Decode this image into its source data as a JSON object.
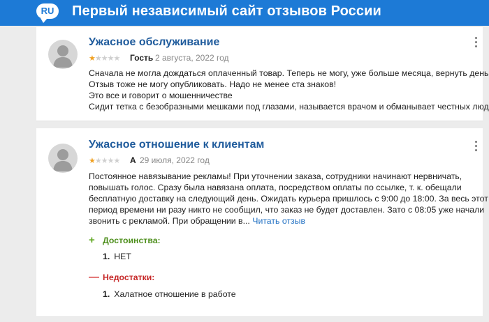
{
  "header": {
    "badge": "RU",
    "title": "Первый независимый сайт отзывов России"
  },
  "reviews": [
    {
      "title": "Ужасное обслуживание",
      "rating": 1,
      "stars_max": 5,
      "author": "Гость",
      "date": "2 августа, 2022 год",
      "lines": [
        "Сначала не могла дождаться оплаченный товар. Теперь не могу, уже больше месяца, вернуть деньги",
        "Отзыв тоже не могу опубликовать. Надо не менее ста знаков!",
        "Это все и говорит о мошенничестве",
        "Сидит тетка с безобразными мешками под глазами, называется врачом и обманывает честных людей"
      ]
    },
    {
      "title": "Ужасное отношение к клиентам",
      "rating": 1,
      "stars_max": 5,
      "author": "А",
      "date": "29 июля, 2022 год",
      "lines": [
        "Постоянное навязывание рекламы! При уточнении заказа, сотрудники начинают нервничать,",
        "повышать голос. Сразу была навязана оплата, посредством оплаты по ссылке, т. к. обещали",
        "бесплатную доставку на следующий день. Ожидать курьера пришлось с 9:00 до 18:00. За весь этот",
        "период времени ни разу никто не сообщил, что заказ не будет доставлен. Зато с 08:05 уже начали"
      ],
      "last_line": "звонить с рекламой. При обращении в...",
      "read_more": "Читать отзыв",
      "pros_label": "Достоинства:",
      "pros": [
        {
          "num": "1.",
          "text": "НЕТ"
        }
      ],
      "cons_label": "Недостатки:",
      "cons": [
        {
          "num": "1.",
          "text": "Халатное отношение в работе"
        }
      ]
    }
  ],
  "colors": {
    "header_bg": "#1d7ad6",
    "title_link": "#1f5b9c",
    "star_on": "#f0a020",
    "star_off": "#cfcfcf",
    "pros": "#5fa721",
    "cons": "#d63636",
    "link": "#1f6fc2"
  },
  "icons": {
    "avatar": "user-silhouette-icon",
    "menu": "vertical-dots-icon",
    "plus": "plus-icon",
    "minus": "minus-icon",
    "star": "star-icon"
  }
}
